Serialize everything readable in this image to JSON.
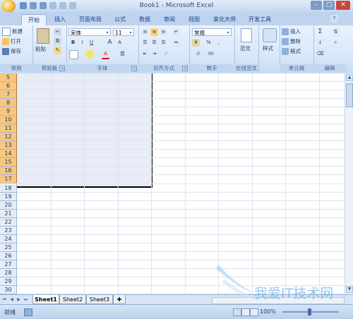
{
  "window": {
    "title": "Book1 - Microsoft Excel"
  },
  "tabs": [
    "开始",
    "插入",
    "页面布局",
    "公式",
    "数据",
    "审阅",
    "视图",
    "美化大师",
    "开发工具"
  ],
  "ribbon": {
    "clipboard": {
      "new": "新建",
      "open": "打开",
      "save": "保存",
      "label": "常用",
      "paste": "粘贴",
      "group": "剪贴板"
    },
    "font": {
      "name": "宋体",
      "size": "11",
      "bold": "B",
      "italic": "I",
      "underline": "U",
      "grow": "A",
      "shrink": "A",
      "color": "A",
      "phonetic": "变",
      "label": "字体"
    },
    "align": {
      "label": "对齐方式"
    },
    "number": {
      "format": "常规",
      "percent": "%",
      "comma": ",",
      "inc_decimal": ".0",
      "dec_decimal": ".00",
      "label": "数字"
    },
    "online": {
      "template": "范文",
      "label": "在线范文"
    },
    "styles": {
      "label": "样式"
    },
    "cells": {
      "insert": "插入",
      "delete": "删除",
      "format": "格式",
      "label": "单元格"
    },
    "editing": {
      "sum": "Σ",
      "label": "编辑"
    }
  },
  "rows": [
    "5",
    "6",
    "7",
    "8",
    "9",
    "10",
    "11",
    "12",
    "13",
    "14",
    "15",
    "16",
    "17",
    "18",
    "19",
    "20",
    "21",
    "22",
    "23",
    "24",
    "25",
    "26",
    "27",
    "28",
    "29",
    "30"
  ],
  "sheets": [
    "Sheet1",
    "Sheet2",
    "Sheet3"
  ],
  "status": {
    "ready": "就绪",
    "zoom": "100%"
  },
  "watermark": "我爱IT技术网",
  "colors": {
    "selected_row_header": "#f8c67c",
    "selection_fill": "#e7ecf6",
    "highlight_box": "#e00000"
  }
}
